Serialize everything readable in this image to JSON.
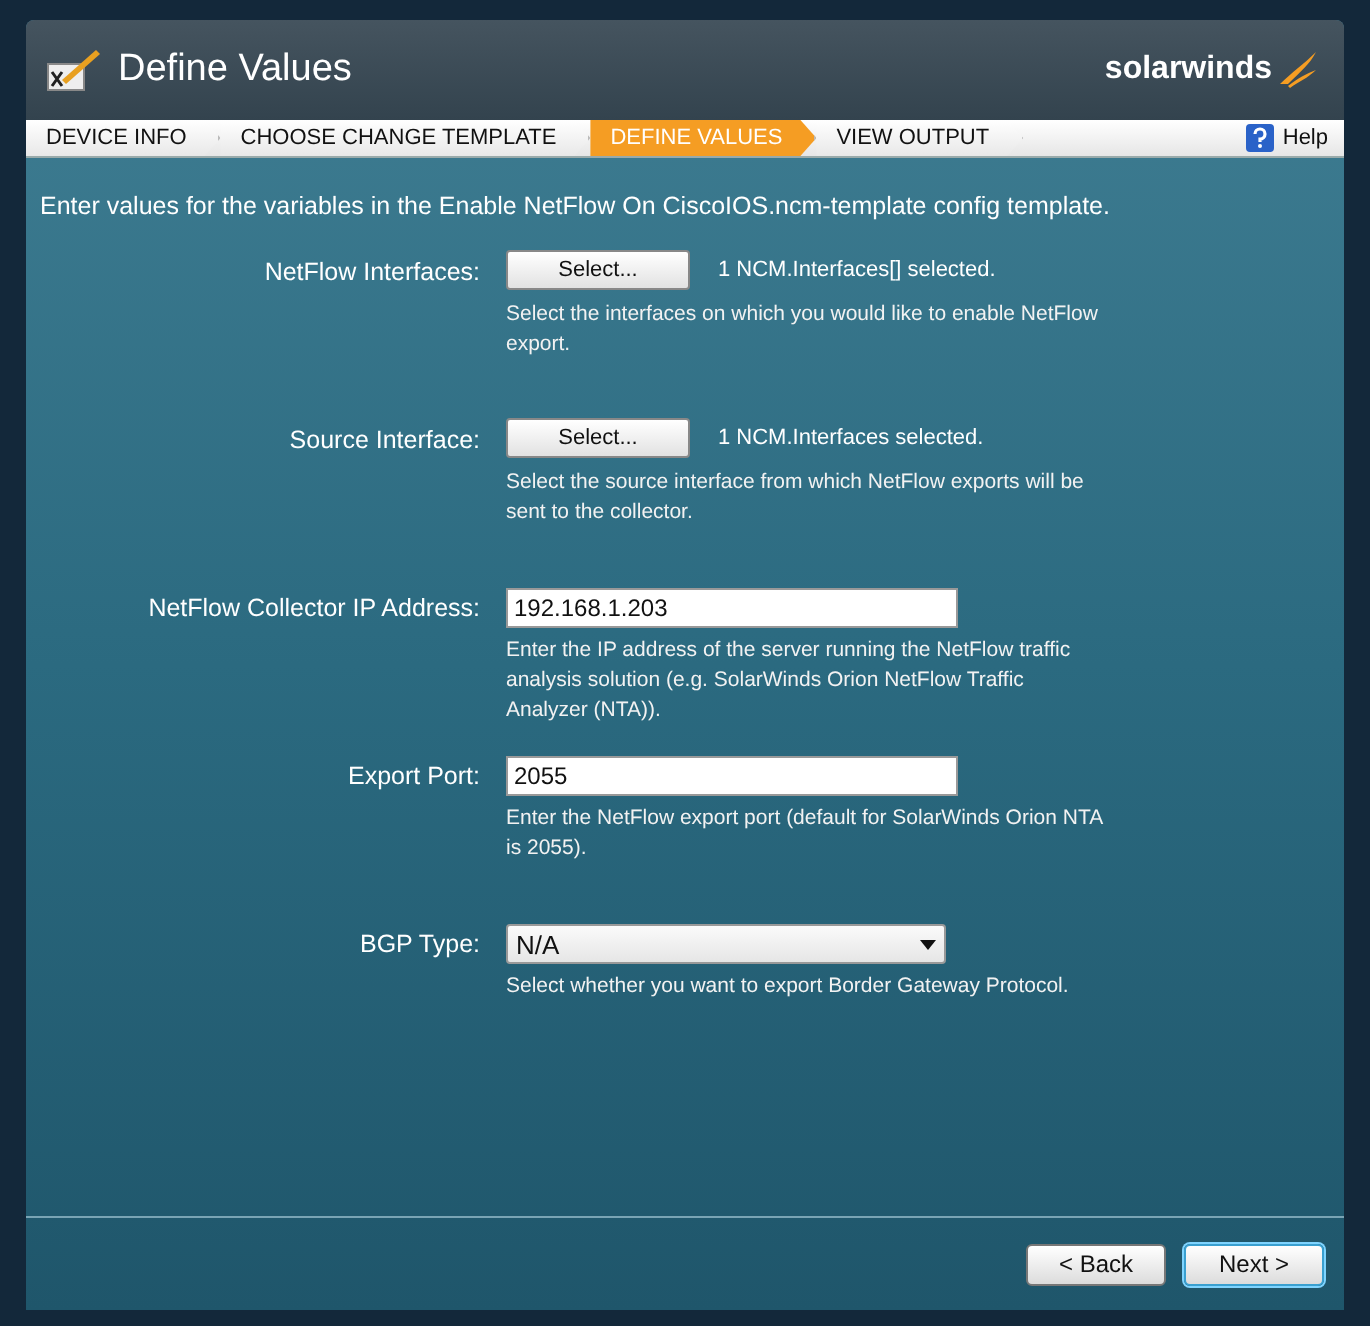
{
  "window": {
    "title": "Define Values",
    "brand": "solarwinds"
  },
  "steps": [
    {
      "label": "DEVICE INFO",
      "selected": false
    },
    {
      "label": "CHOOSE CHANGE TEMPLATE",
      "selected": false
    },
    {
      "label": "DEFINE VALUES",
      "selected": true
    },
    {
      "label": "VIEW OUTPUT",
      "selected": false
    }
  ],
  "help": {
    "label": "Help"
  },
  "intro": "Enter values for the variables in the Enable NetFlow On CiscoIOS.ncm-template config template.",
  "fields": [
    {
      "kind": "button",
      "label": "NetFlow Interfaces:",
      "button": "Select...",
      "status": "1 NCM.Interfaces[] selected.",
      "hint": "Select the interfaces on which you would like to enable NetFlow export."
    },
    {
      "kind": "button",
      "label": "Source Interface:",
      "button": "Select...",
      "status": "1 NCM.Interfaces selected.",
      "hint": "Select the source interface from which NetFlow exports will be sent to the collector."
    },
    {
      "kind": "text",
      "label": "NetFlow Collector IP Address:",
      "value": "192.168.1.203",
      "hint": "Enter the IP address of the server running the NetFlow traffic analysis solution (e.g. SolarWinds Orion NetFlow Traffic Analyzer (NTA))."
    },
    {
      "kind": "text",
      "label": "Export Port:",
      "value": "2055",
      "hint": "Enter the NetFlow export port (default for SolarWinds Orion NTA is 2055)."
    },
    {
      "kind": "select",
      "label": "BGP Type:",
      "value": "N/A",
      "hint": "Select whether you want to export Border Gateway Protocol."
    }
  ],
  "buttons": [
    {
      "label": "< Back",
      "selected": false
    },
    {
      "label": "Next >",
      "selected": true
    }
  ]
}
